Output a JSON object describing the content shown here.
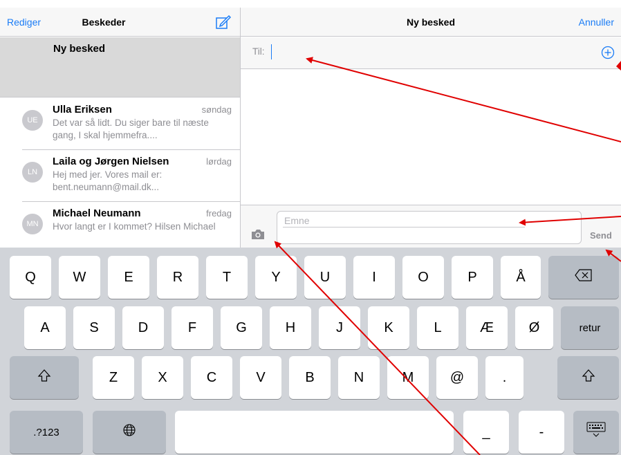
{
  "left_pane": {
    "edit_label": "Rediger",
    "title": "Beskeder",
    "compose_icon": "compose-icon",
    "new_message_row": "Ny besked",
    "conversations": [
      {
        "initials": "UE",
        "name": "Ulla Eriksen",
        "day": "søndag",
        "preview": "Det var så lidt. Du siger bare til næste gang, I skal hjemmefra...."
      },
      {
        "initials": "LN",
        "name": "Laila og Jørgen Nielsen",
        "day": "lørdag",
        "preview": "Hej med jer.  Vores mail er: bent.neumann@mail.dk..."
      },
      {
        "initials": "MN",
        "name": "Michael Neumann",
        "day": "fredag",
        "preview": "Hvor langt er I kommet? Hilsen Michael"
      }
    ]
  },
  "right_pane": {
    "title": "Ny besked",
    "cancel_label": "Annuller",
    "to_label": "Til:",
    "to_value": "",
    "add_contact_icon": "plus-circle-icon",
    "camera_icon": "camera-icon",
    "subject_placeholder": "Emne",
    "send_label": "Send"
  },
  "keyboard": {
    "row1": [
      "Q",
      "W",
      "E",
      "R",
      "T",
      "Y",
      "U",
      "I",
      "O",
      "P",
      "Å"
    ],
    "row2": [
      "A",
      "S",
      "D",
      "F",
      "G",
      "H",
      "J",
      "K",
      "L",
      "Æ",
      "Ø"
    ],
    "row3": [
      "Z",
      "X",
      "C",
      "V",
      "B",
      "N",
      "M",
      "@",
      "."
    ],
    "return_label": "retur",
    "numbers_label": ".?123",
    "underscore_label": "_",
    "dash_label": "-",
    "icons": {
      "backspace": "backspace-icon",
      "shift": "shift-icon",
      "globe": "globe-icon",
      "hide_keyboard": "keyboard-hide-icon"
    }
  },
  "colors": {
    "accent": "#1a7cf6",
    "annotation_arrow": "#e00000",
    "keyboard_bg": "#d1d4d9",
    "key_light": "#ffffff",
    "key_dark": "#b6bcc4"
  }
}
